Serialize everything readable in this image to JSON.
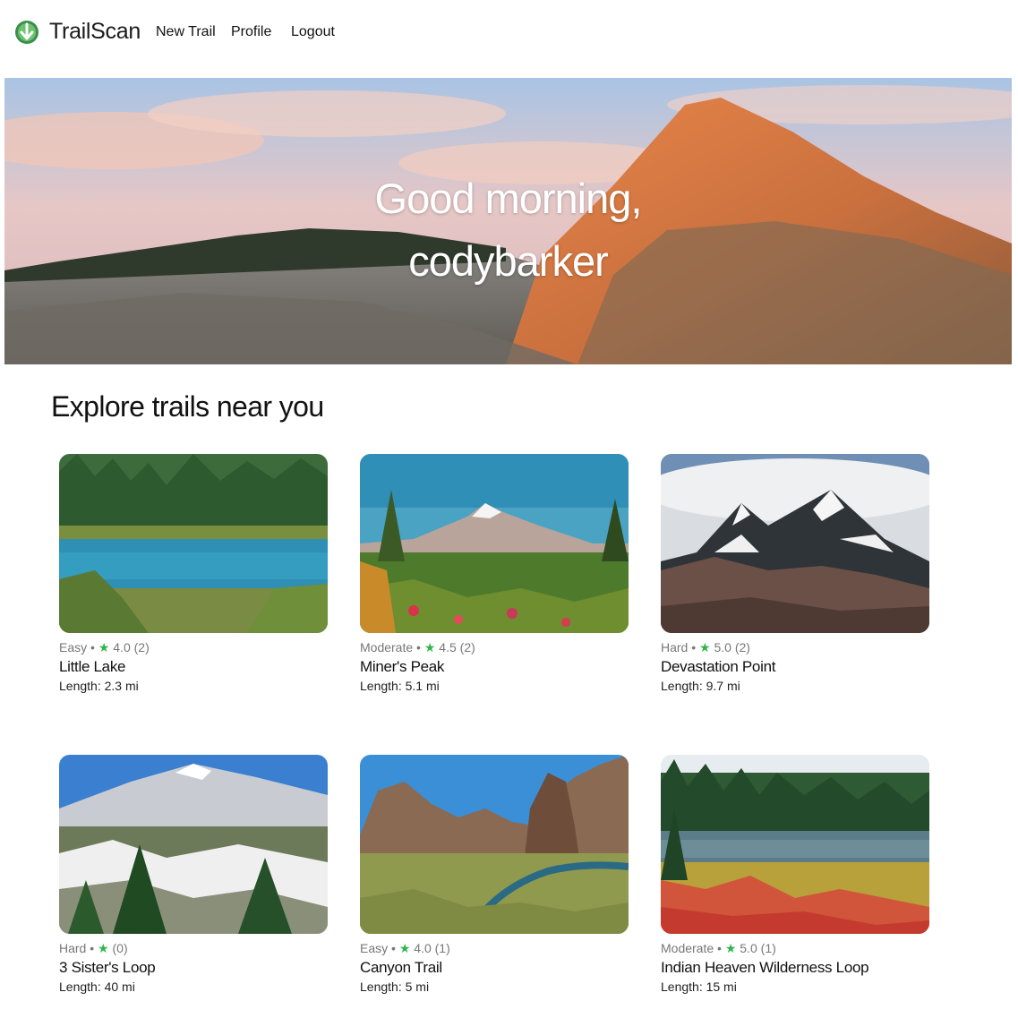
{
  "nav": {
    "brand": "TrailScan",
    "logo_icon": "trailscan-logo-icon",
    "links": [
      {
        "label": "New Trail"
      },
      {
        "label": "Profile"
      },
      {
        "label": "Logout"
      }
    ]
  },
  "hero": {
    "greeting_line1": "Good morning,",
    "greeting_line2": "codybarker"
  },
  "section": {
    "title": "Explore trails near you"
  },
  "colors": {
    "accent_green": "#2fb54a",
    "muted_text": "#777777"
  },
  "trails": [
    {
      "difficulty": "Easy",
      "rating": "4.0",
      "count": "(2)",
      "name": "Little Lake",
      "length": "Length: 2.3 mi"
    },
    {
      "difficulty": "Moderate",
      "rating": "4.5",
      "count": "(2)",
      "name": "Miner's Peak",
      "length": "Length: 5.1 mi"
    },
    {
      "difficulty": "Hard",
      "rating": "5.0",
      "count": "(2)",
      "name": "Devastation Point",
      "length": "Length: 9.7 mi"
    },
    {
      "difficulty": "Hard",
      "rating": "",
      "count": "(0)",
      "name": "3 Sister's Loop",
      "length": "Length: 40 mi"
    },
    {
      "difficulty": "Easy",
      "rating": "4.0",
      "count": "(1)",
      "name": "Canyon Trail",
      "length": "Length: 5 mi"
    },
    {
      "difficulty": "Moderate",
      "rating": "5.0",
      "count": "(1)",
      "name": "Indian Heaven Wilderness Loop",
      "length": "Length: 15 mi"
    }
  ]
}
